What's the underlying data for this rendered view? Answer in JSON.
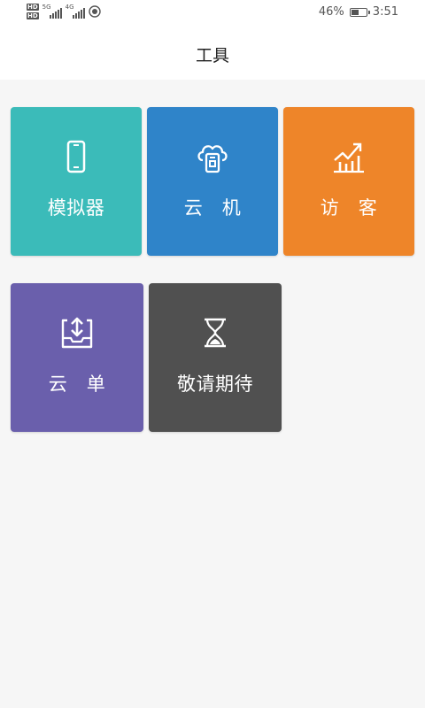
{
  "status_bar": {
    "hd_top": "HD",
    "hd_bottom": "HD",
    "net_1": "5G",
    "net_2": "4G",
    "battery_percent": "46%",
    "battery_level": 0.46,
    "time": "3:51"
  },
  "header": {
    "title": "工具"
  },
  "tiles": [
    {
      "label": "模拟器",
      "icon": "phone-icon",
      "color": "#3bbbb9"
    },
    {
      "label": "云　机",
      "icon": "cloud-phone-icon",
      "color": "#2f84c9"
    },
    {
      "label": "访　客",
      "icon": "chart-growth-icon",
      "color": "#ee8529"
    },
    {
      "label": "云　单",
      "icon": "tray-upload-icon",
      "color": "#6a5fac"
    },
    {
      "label": "敬请期待",
      "icon": "hourglass-icon",
      "color": "#505050"
    }
  ]
}
